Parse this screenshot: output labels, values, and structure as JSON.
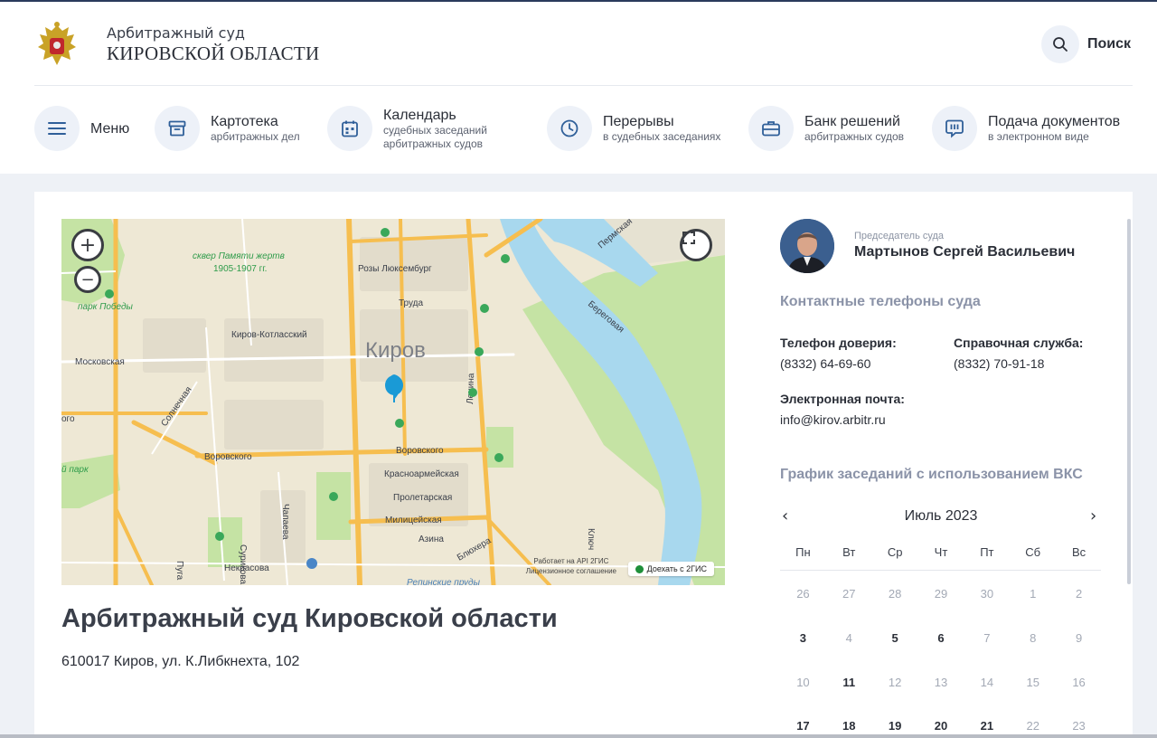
{
  "header": {
    "court_subtitle": "Арбитражный суд",
    "court_title": "КИРОВСКОЙ ОБЛАСТИ",
    "search_label": "Поиск"
  },
  "nav": [
    {
      "title": "Меню",
      "subtitle": "",
      "icon": "menu-icon"
    },
    {
      "title": "Картотека",
      "subtitle": "арбитражных дел",
      "icon": "archive-box-icon"
    },
    {
      "title": "Календарь",
      "subtitle": "судебных заседаний",
      "subtitle2": "арбитражных судов",
      "icon": "calendar-icon"
    },
    {
      "title": "Перерывы",
      "subtitle": "в судебных заседаниях",
      "icon": "clock-icon"
    },
    {
      "title": "Банк решений",
      "subtitle": "арбитражных судов",
      "icon": "briefcase-icon"
    },
    {
      "title": "Подача документов",
      "subtitle": "в электронном виде",
      "icon": "chat-bubble-icon"
    }
  ],
  "map": {
    "city_label": "Киров",
    "labels": {
      "square": "сквер Памяти жертв",
      "square_years": "1905-1907 гг.",
      "park_pobedy": "парк Победы",
      "kirov_kotlassky": "Киров-Котласский",
      "moskovskaya": "Московская",
      "solnechnaya": "Солнечная",
      "rozy": "Розы Люксембург",
      "truda": "Труда",
      "vorovskogo_left": "Воровского",
      "vorovskogo_right": "Воровского",
      "krasnoarm": "Красноармейская",
      "proletar": "Пролетарская",
      "milic": "Милицейская",
      "azina": "Азина",
      "bluhera": "Блюхера",
      "surikova": "Сурикова",
      "chapaeva": "Чапаева",
      "nekrasova": "Некрасова",
      "lenina": "Ленина",
      "beregovaya": "Береговая",
      "permskaya": "Пермская",
      "park_left": "й парк",
      "oro": "ого",
      "pugach": "Пуга",
      "klyuch": "Ключ",
      "repin": "Репинские пруды"
    },
    "attribution_1": "Работает на API 2ГИС",
    "attribution_2": "Лицензионное соглашение",
    "route_label": "Доехать с 2ГИС",
    "zoom_in": "+",
    "zoom_out": "−"
  },
  "org": {
    "name": "Арбитражный суд Кировской области",
    "address": "610017 Киров, ул. К.Либкнехта, 102"
  },
  "chairman": {
    "role": "Председатель суда",
    "name": "Мартынов Сергей Васильевич"
  },
  "contacts": {
    "section_title": "Контактные телефоны суда",
    "trust_label": "Телефон доверия:",
    "trust_value": "(8332) 64-69-60",
    "info_label": "Справочная служба:",
    "info_value": "(8332) 70-91-18",
    "email_label": "Электронная почта:",
    "email_value": "info@kirov.arbitr.ru"
  },
  "calendar": {
    "section_title": "График заседаний с использованием ВКС",
    "month": "Июль 2023",
    "prev": "‹",
    "next": "›",
    "weekdays": [
      "Пн",
      "Вт",
      "Ср",
      "Чт",
      "Пт",
      "Сб",
      "Вс"
    ],
    "rows": [
      [
        {
          "d": "26",
          "b": false
        },
        {
          "d": "27",
          "b": false
        },
        {
          "d": "28",
          "b": false
        },
        {
          "d": "29",
          "b": false
        },
        {
          "d": "30",
          "b": false
        },
        {
          "d": "1",
          "b": false
        },
        {
          "d": "2",
          "b": false
        }
      ],
      [
        {
          "d": "3",
          "b": true
        },
        {
          "d": "4",
          "b": false
        },
        {
          "d": "5",
          "b": true
        },
        {
          "d": "6",
          "b": true
        },
        {
          "d": "7",
          "b": false
        },
        {
          "d": "8",
          "b": false
        },
        {
          "d": "9",
          "b": false
        }
      ],
      [
        {
          "d": "10",
          "b": false
        },
        {
          "d": "11",
          "b": true
        },
        {
          "d": "12",
          "b": false
        },
        {
          "d": "13",
          "b": false
        },
        {
          "d": "14",
          "b": false
        },
        {
          "d": "15",
          "b": false
        },
        {
          "d": "16",
          "b": false
        }
      ],
      [
        {
          "d": "17",
          "b": true
        },
        {
          "d": "18",
          "b": true
        },
        {
          "d": "19",
          "b": true
        },
        {
          "d": "20",
          "b": true
        },
        {
          "d": "21",
          "b": true
        },
        {
          "d": "22",
          "b": false
        },
        {
          "d": "23",
          "b": false
        }
      ]
    ]
  },
  "colors": {
    "accent_bg": "#edf1f8",
    "icon": "#2f5f99",
    "map_water": "#a8d8ee",
    "map_green": "#c5e3a4",
    "map_road": "#f6be4f"
  }
}
